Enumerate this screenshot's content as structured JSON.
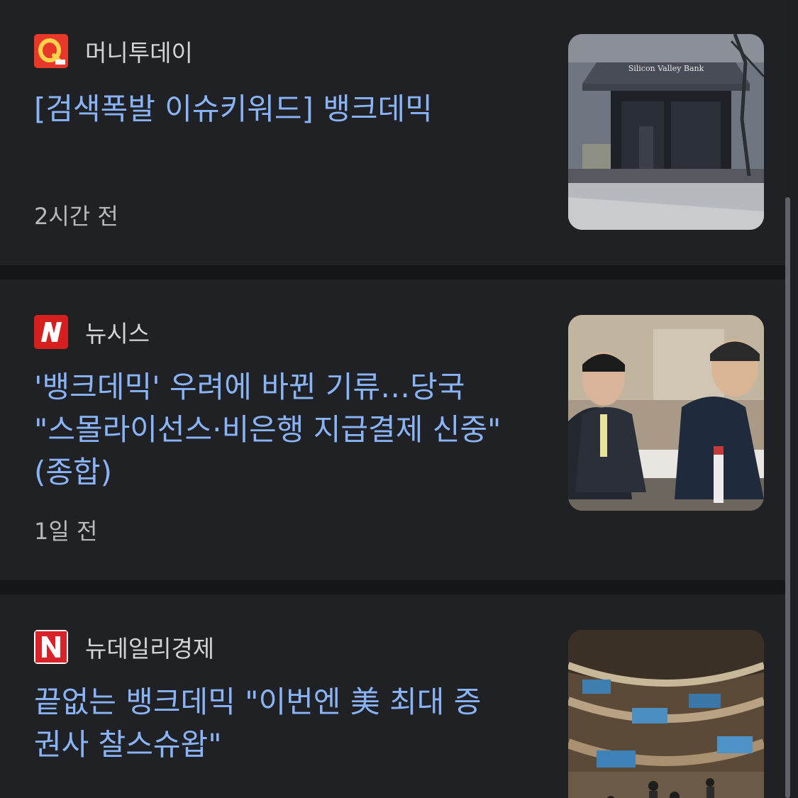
{
  "articles": [
    {
      "source": "머니투데이",
      "logo_icon": "moneytoday-logo-icon",
      "logo_color": "#e8382a",
      "headline": "[검색폭발 이슈키워드] 뱅크데믹",
      "time": "2시간 전",
      "thumb_icon": "bank-storefront-photo",
      "thumb_sign": "Silicon Valley Bank"
    },
    {
      "source": "뉴시스",
      "logo_icon": "newsis-logo-icon",
      "logo_color": "#d6201f",
      "headline": "'뱅크데믹' 우려에 바뀐 기류…당국\n\"스몰라이선스·비은행 지급결제 신중\"\n(종합)",
      "time": "1일 전",
      "thumb_icon": "meeting-officials-photo"
    },
    {
      "source": "뉴데일리경제",
      "logo_icon": "newdaily-logo-icon",
      "logo_color": "#d9232a",
      "headline": "끝없는 뱅크데믹 \"이번엔 美 최대 증\n권사 찰스슈왑\"",
      "thumb_icon": "stock-exchange-floor-photo"
    }
  ],
  "colors": {
    "background": "#202124",
    "separator": "#151619",
    "headline": "#8ab4f8",
    "source": "#d3d4d7",
    "time": "#b7b9bd"
  }
}
